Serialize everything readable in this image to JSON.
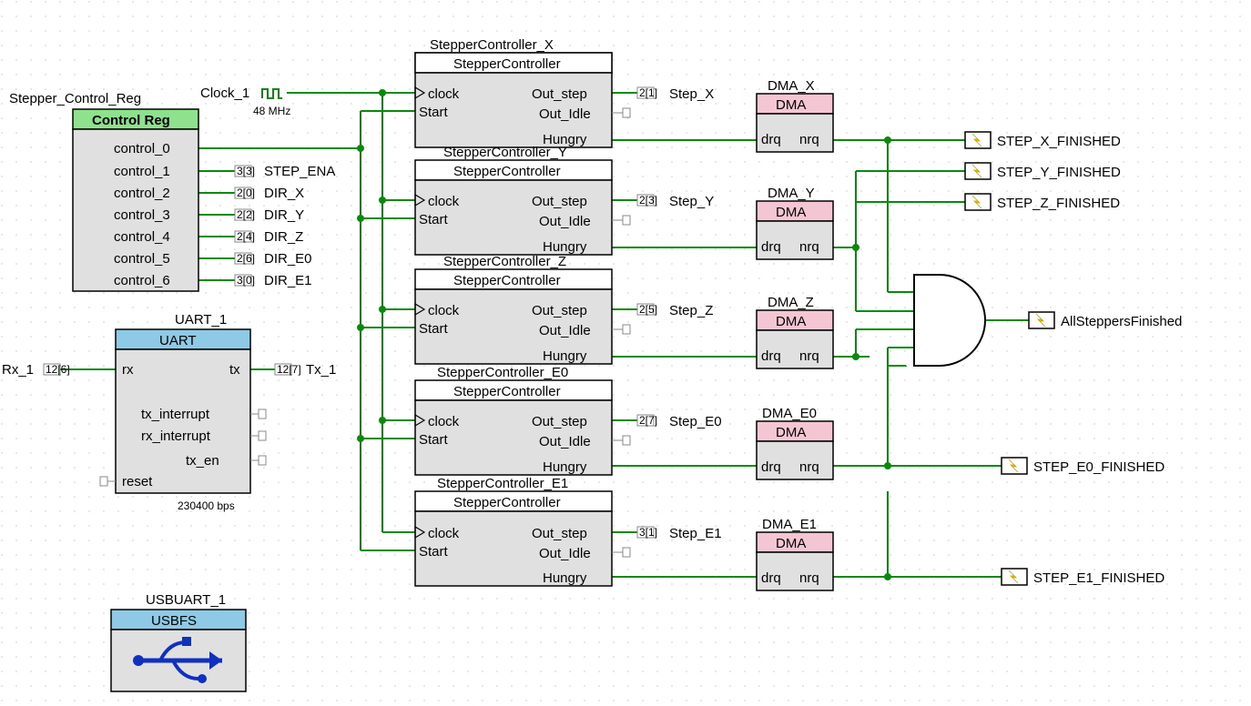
{
  "control_reg": {
    "instance_name": "Stepper_Control_Reg",
    "title": "Control Reg",
    "signals": {
      "c0": "control_0",
      "c1": "control_1",
      "c2": "control_2",
      "c3": "control_3",
      "c4": "control_4",
      "c5": "control_5",
      "c6": "control_6"
    },
    "nets": {
      "ena": "STEP_ENA",
      "dirx": "DIR_X",
      "diry": "DIR_Y",
      "dirz": "DIR_Z",
      "dire0": "DIR_E0",
      "dire1": "DIR_E1"
    },
    "pins": {
      "ena": "3[3]",
      "dirx": "2[0]",
      "diry": "2[2]",
      "dirz": "2[4]",
      "dire0": "2[6]",
      "dire1": "3[0]"
    }
  },
  "clock": {
    "name": "Clock_1",
    "freq": "48 MHz"
  },
  "stepper": {
    "type_label": "StepperController",
    "port_clock": "clock",
    "port_start": "Start",
    "port_step": "Out_step",
    "port_idle": "Out_Idle",
    "port_hungry": "Hungry",
    "x": {
      "name": "StepperController_X",
      "net": "Step_X",
      "pin": "2[1]"
    },
    "y": {
      "name": "StepperController_Y",
      "net": "Step_Y",
      "pin": "2[3]"
    },
    "z": {
      "name": "StepperController_Z",
      "net": "Step_Z",
      "pin": "2[5]"
    },
    "e0": {
      "name": "StepperController_E0",
      "net": "Step_E0",
      "pin": "2[7]"
    },
    "e1": {
      "name": "StepperController_E1",
      "net": "Step_E1",
      "pin": "3[1]"
    }
  },
  "dma": {
    "title": "DMA",
    "port_drq": "drq",
    "port_nrq": "nrq",
    "x": {
      "name": "DMA_X"
    },
    "y": {
      "name": "DMA_Y"
    },
    "z": {
      "name": "DMA_Z"
    },
    "e0": {
      "name": "DMA_E0"
    },
    "e1": {
      "name": "DMA_E1"
    }
  },
  "isr": {
    "x": "STEP_X_FINISHED",
    "y": "STEP_Y_FINISHED",
    "z": "STEP_Z_FINISHED",
    "e0": "STEP_E0_FINISHED",
    "e1": "STEP_E1_FINISHED",
    "all": "AllSteppersFinished"
  },
  "uart": {
    "name": "UART_1",
    "title": "UART",
    "rate": "230400 bps",
    "ports": {
      "rx": "rx",
      "tx": "tx",
      "txi": "tx_interrupt",
      "rxi": "rx_interrupt",
      "txen": "tx_en",
      "reset": "reset"
    },
    "nets": {
      "rx": "Rx_1",
      "tx": "Tx_1",
      "rxpin": "12[6]",
      "txpin": "12[7]"
    }
  },
  "usb": {
    "name": "USBUART_1",
    "title": "USBFS"
  }
}
